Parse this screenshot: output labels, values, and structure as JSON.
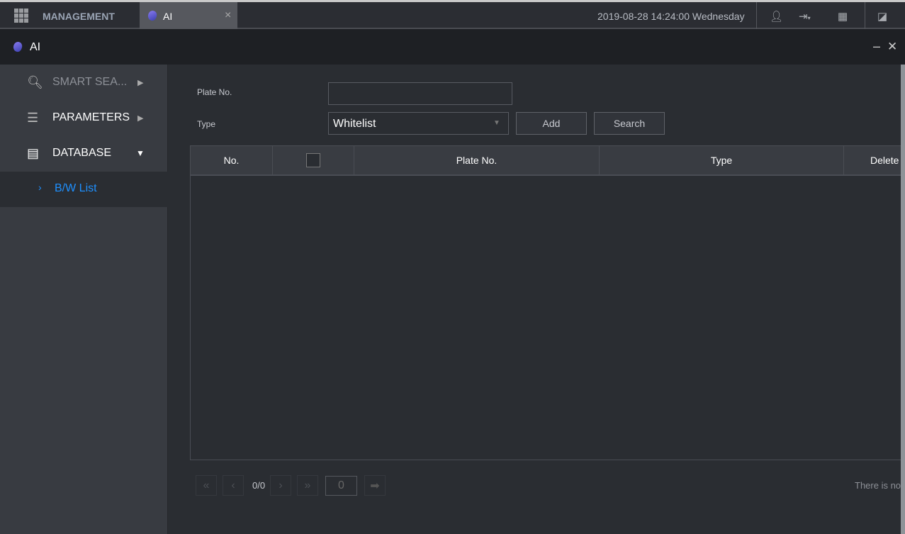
{
  "topbar": {
    "management_label": "MANAGEMENT",
    "active_tab": "AI",
    "close": "×",
    "datetime": "2019-08-28 14:24:00 Wednesday"
  },
  "window": {
    "title": "AI",
    "minimize": "–",
    "close": "✕"
  },
  "sidebar": {
    "items": [
      {
        "label": "SMART SEA..."
      },
      {
        "label": "PARAMETERS"
      },
      {
        "label": "DATABASE"
      }
    ],
    "sub_item": {
      "label": "B/W List"
    }
  },
  "form": {
    "plate_label": "Plate No.",
    "plate_value": "",
    "type_label": "Type",
    "type_value": "Whitelist",
    "add": "Add",
    "search": "Search"
  },
  "table": {
    "columns": [
      "No.",
      "",
      "Plate No.",
      "Type",
      "Delete"
    ]
  },
  "pager": {
    "page": "0/0",
    "goto_value": "0",
    "status": "There is no"
  },
  "colors": {
    "accent": "#1e90ff"
  }
}
